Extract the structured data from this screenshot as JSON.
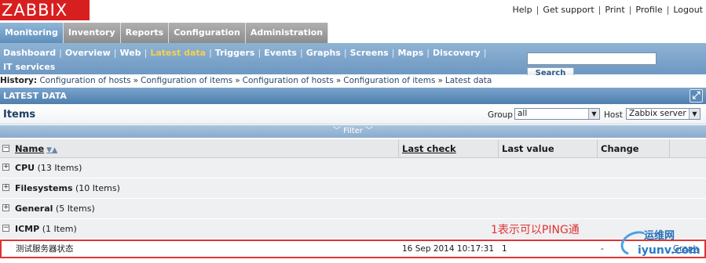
{
  "header": {
    "logo": "ZABBIX",
    "links": [
      "Help",
      "Get support",
      "Print",
      "Profile",
      "Logout"
    ]
  },
  "main_menu": [
    {
      "label": "Monitoring",
      "active": true
    },
    {
      "label": "Inventory",
      "active": false
    },
    {
      "label": "Reports",
      "active": false
    },
    {
      "label": "Configuration",
      "active": false
    },
    {
      "label": "Administration",
      "active": false
    }
  ],
  "sub_menu": [
    {
      "label": "Dashboard",
      "active": false
    },
    {
      "label": "Overview",
      "active": false
    },
    {
      "label": "Web",
      "active": false
    },
    {
      "label": "Latest data",
      "active": true
    },
    {
      "label": "Triggers",
      "active": false
    },
    {
      "label": "Events",
      "active": false
    },
    {
      "label": "Graphs",
      "active": false
    },
    {
      "label": "Screens",
      "active": false
    },
    {
      "label": "Maps",
      "active": false
    },
    {
      "label": "Discovery",
      "active": false
    },
    {
      "label": "IT services",
      "active": false
    }
  ],
  "search": {
    "value": "",
    "button": "Search"
  },
  "history": {
    "label": "History:",
    "items": [
      "Configuration of hosts",
      "Configuration of items",
      "Configuration of hosts",
      "Configuration of items",
      "Latest data"
    ]
  },
  "section_title": "LATEST DATA",
  "items_title": "Items",
  "filters": {
    "group_label": "Group",
    "group_value": "all",
    "host_label": "Host",
    "host_value": "Zabbix server"
  },
  "filter_bar": "Filter",
  "table": {
    "columns": [
      "Name",
      "Last check",
      "Last value",
      "Change"
    ],
    "groups": [
      {
        "name": "CPU",
        "count": "(13 Items)",
        "toggle": "+"
      },
      {
        "name": "Filesystems",
        "count": "(10 Items)",
        "toggle": "+"
      },
      {
        "name": "General",
        "count": "(5 Items)",
        "toggle": "+"
      },
      {
        "name": "ICMP",
        "count": "(1 Item)",
        "toggle": "−"
      }
    ],
    "item": {
      "name": "测试服务器状态",
      "last_check": "16 Sep 2014 10:17:31",
      "last_value": "1",
      "change": "-",
      "graph": "Graph"
    }
  },
  "annotation": "1表示可以PING通",
  "watermark": {
    "line1": "运维网",
    "line2": "iyunv.com"
  },
  "colors": {
    "logo_bg": "#d81f20",
    "active_sub": "#f7d04a",
    "annotation": "#e23232"
  }
}
